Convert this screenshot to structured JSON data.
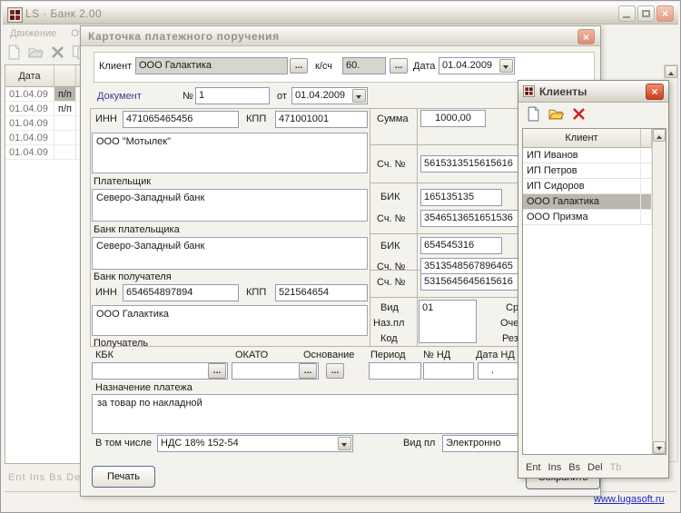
{
  "colors": {
    "selection": "#b8b5ad",
    "link": "#2222cc",
    "close_button": "#cc3b1c"
  },
  "main": {
    "title": "LS · Банк 2.00",
    "menu": [
      "Движение",
      "Отч"
    ],
    "toolbar_icons": [
      "new-doc-icon",
      "open-folder-icon",
      "delete-icon",
      "copy-icon"
    ],
    "table": {
      "date_header": "Дата",
      "rows": [
        {
          "date": "01.04.09",
          "type": "п/п"
        },
        {
          "date": "01.04.09",
          "type": "п/п"
        },
        {
          "date": "01.04.09",
          "type": ""
        },
        {
          "date": "01.04.09",
          "type": ""
        },
        {
          "date": "01.04.09",
          "type": ""
        }
      ]
    },
    "status": "Ent  Ins  Bs  De",
    "link": "www.lugasoft.ru"
  },
  "dialog": {
    "title": "Карточка платежного поручения",
    "client": {
      "label": "Клиент",
      "value": "ООО Галактика",
      "browse": "…"
    },
    "ksch": {
      "label": "к/сч",
      "value": "60."
    },
    "date": {
      "label": "Дата",
      "value": "01.04.2009"
    },
    "doc": {
      "label": "Документ",
      "no_label": "№",
      "no": "1",
      "from_label": "от",
      "date": "01.04.2009"
    },
    "amount": {
      "label": "Сумма",
      "value": "1000,00"
    },
    "payer": {
      "inn_label": "ИНН",
      "inn": "471065465456",
      "kpp_label": "КПП",
      "kpp": "471001001",
      "name": "ООО \"Мотылек\"",
      "caption": "Плательщик",
      "acc_label": "Сч. №",
      "acc": "5615313515615616"
    },
    "payer_bank": {
      "name": "Северо-Западный банк",
      "caption": "Банк плательщика",
      "bik_label": "БИК",
      "bik": "165135135",
      "acc_label": "Сч. №",
      "acc": "3546513651651536"
    },
    "recv_bank": {
      "name": "Северо-Западный банк",
      "caption": "Банк получателя",
      "bik_label": "БИК",
      "bik": "654545316",
      "acc_label": "Сч. №",
      "acc": "3513548567896465"
    },
    "recv": {
      "inn_label": "ИНН",
      "inn": "654654897894",
      "kpp_label": "КПП",
      "kpp": "521564654",
      "name": "ООО Галактика",
      "caption": "Получатель",
      "acc_label": "Сч. №",
      "acc": "5315645645615616"
    },
    "vid": {
      "label": "Вид",
      "value": "01",
      "right_label": "Сро"
    },
    "nazpl": {
      "label": "Наз.пл",
      "right_label": "Очер."
    },
    "kod": {
      "label": "Код",
      "right_label": "Рез.п"
    },
    "kbk_label": "КБК",
    "okato_label": "ОКАТО",
    "osn_label": "Основание",
    "period_label": "Период",
    "nd_label": "№ НД",
    "datand_label": "Дата НД",
    "datand_value": ". .",
    "purpose": {
      "label": "Назначение платежа",
      "value": "за товар по накладной"
    },
    "vtom": {
      "label": "В том числе",
      "value": "НДС 18% 152-54"
    },
    "vidpl": {
      "label": "Вид пл",
      "value": "Электронно"
    },
    "print_btn": "Печать",
    "save_btn": "Сохранить"
  },
  "clients": {
    "title": "Клиенты",
    "toolbar_icons": [
      "new-doc-icon",
      "open-folder-icon",
      "delete-icon"
    ],
    "header": "Клиент",
    "rows": [
      "ИП Иванов",
      "ИП Петров",
      "ИП Сидоров",
      "ООО Галактика",
      "ООО Призма"
    ],
    "selected": "ООО Галактика",
    "status": [
      "Ent",
      "Ins",
      "Bs",
      "Del",
      "Tb"
    ]
  }
}
